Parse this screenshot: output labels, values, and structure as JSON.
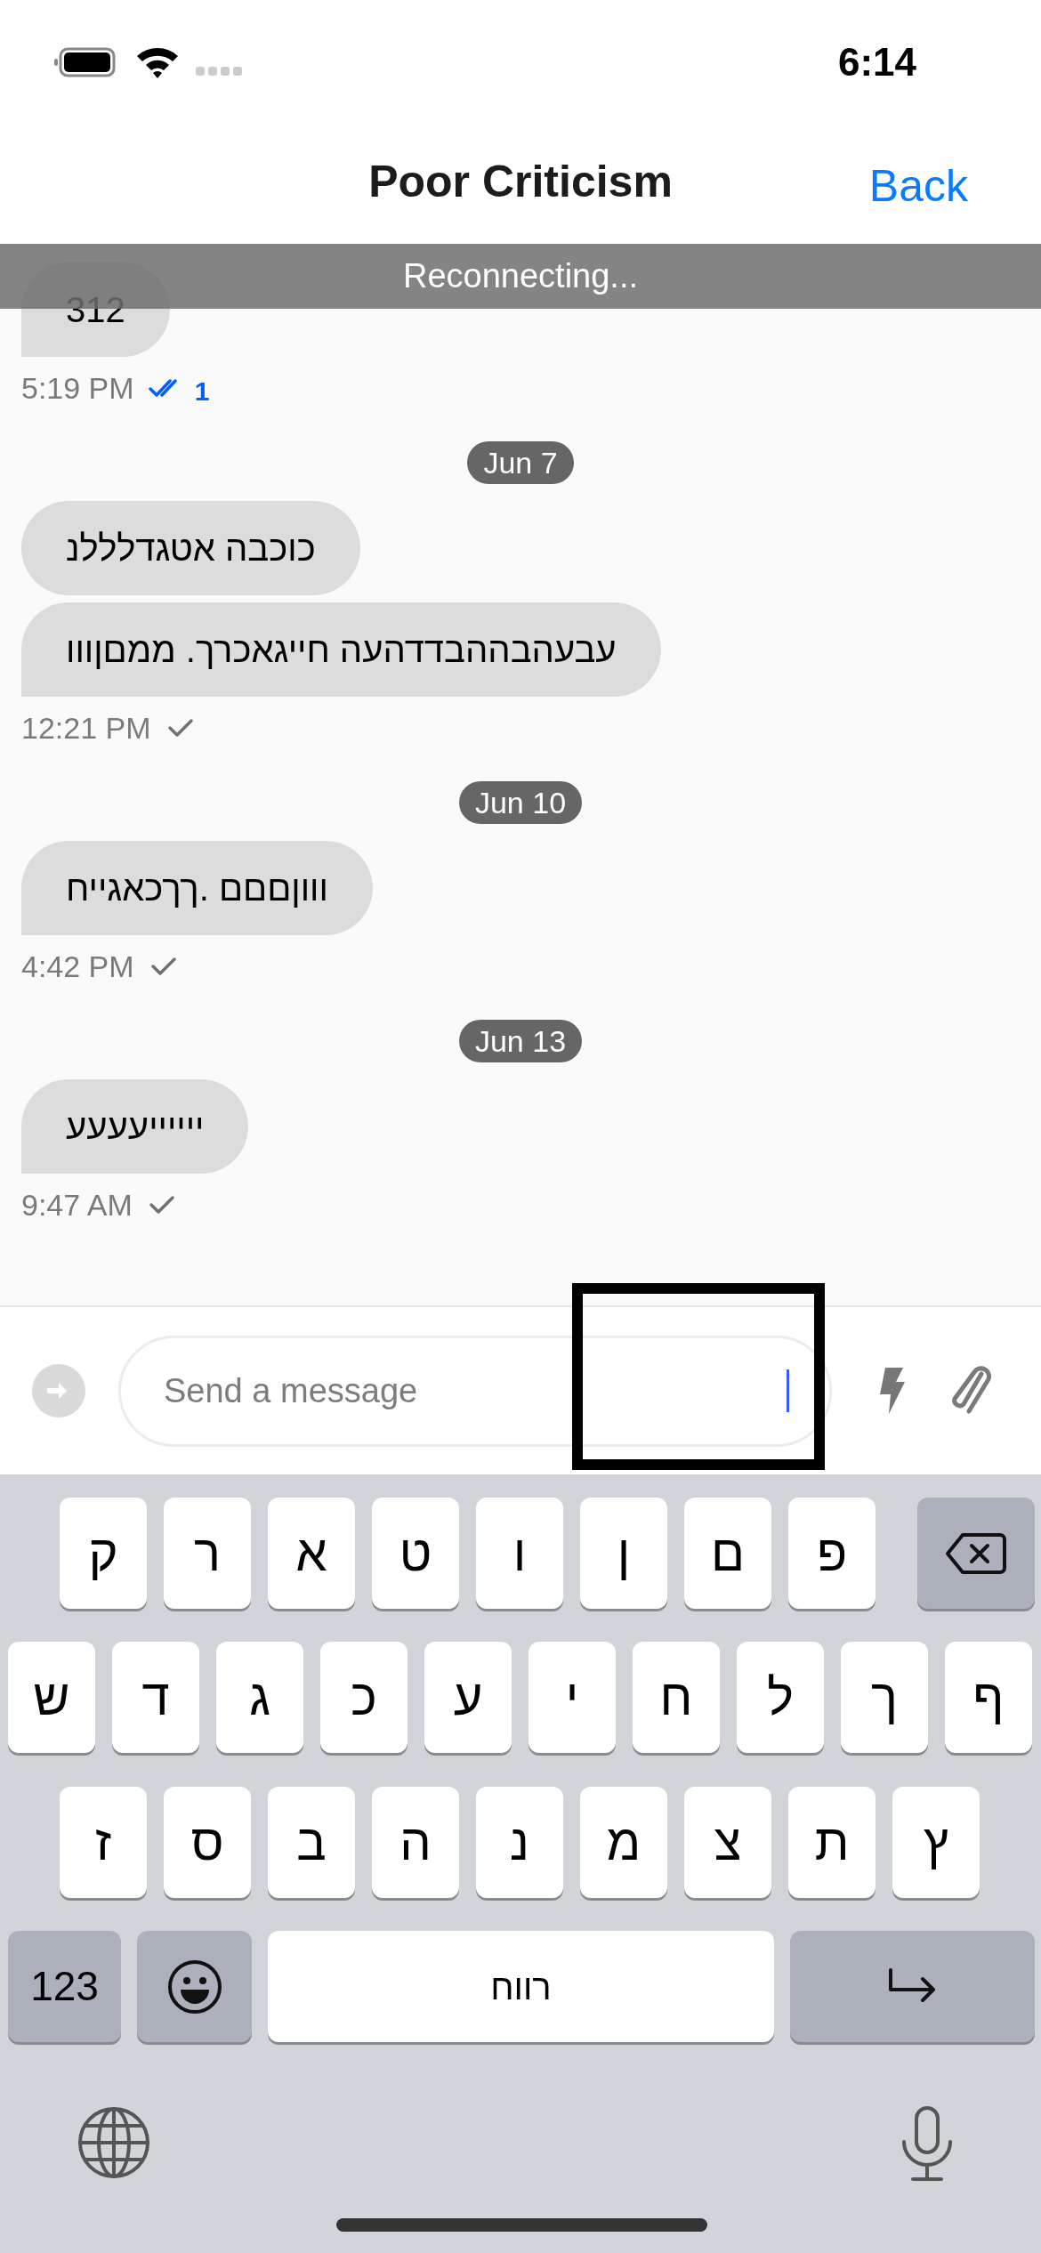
{
  "status_bar": {
    "time": "6:14"
  },
  "header": {
    "title": "Poor Criticism",
    "back": "Back"
  },
  "banner": {
    "text": "Reconnecting..."
  },
  "messages": [
    {
      "kind": "bubble",
      "text": "312",
      "tail": true
    },
    {
      "kind": "meta",
      "time": "5:19 PM",
      "read": true,
      "read_count": "1"
    },
    {
      "kind": "date",
      "text": "Jun 7"
    },
    {
      "kind": "bubble",
      "text": "כוכבה אטגדלללנ",
      "tail": false
    },
    {
      "kind": "bubble",
      "text": "עבעהבההבדדהעה חייגאכרך. ממםןווו",
      "tail": true
    },
    {
      "kind": "meta",
      "time": "12:21 PM",
      "read": false
    },
    {
      "kind": "date",
      "text": "Jun 10"
    },
    {
      "kind": "bubble",
      "text": "וווןםםם .ךךכאגייח",
      "tail": true
    },
    {
      "kind": "meta",
      "time": "4:42 PM",
      "read": false
    },
    {
      "kind": "date",
      "text": "Jun 13"
    },
    {
      "kind": "bubble",
      "text": "ייייייעעעע",
      "tail": true
    },
    {
      "kind": "meta",
      "time": "9:47 AM",
      "read": false
    }
  ],
  "composer": {
    "placeholder": "Send a message",
    "focused": true
  },
  "keyboard": {
    "rows": [
      [
        "ק",
        "ר",
        "א",
        "ט",
        "ו",
        "ן",
        "ם",
        "פ"
      ],
      [
        "ש",
        "ד",
        "ג",
        "כ",
        "ע",
        "י",
        "ח",
        "ל",
        "ך",
        "ף"
      ],
      [
        "ז",
        "ס",
        "ב",
        "ה",
        "נ",
        "מ",
        "צ",
        "ת",
        "ץ"
      ]
    ],
    "numbers_key": "123",
    "space_key": "רווח"
  }
}
